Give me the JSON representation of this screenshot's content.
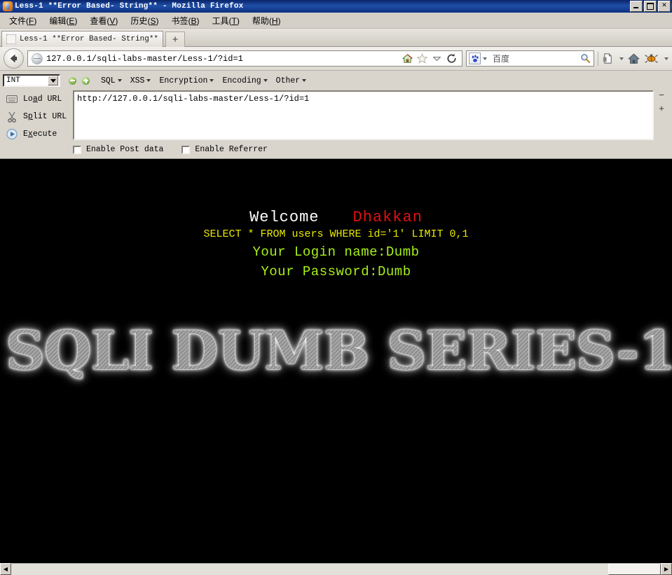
{
  "window": {
    "title": "Less-1 **Error Based- String** - Mozilla Firefox",
    "minimize_label": "Minimize",
    "restore_label": "Restore",
    "close_label": "✕"
  },
  "menubar": {
    "items": [
      {
        "text": "文件",
        "accel": "F"
      },
      {
        "text": "编辑",
        "accel": "E"
      },
      {
        "text": "查看",
        "accel": "V"
      },
      {
        "text": "历史",
        "accel": "S"
      },
      {
        "text": "书签",
        "accel": "B"
      },
      {
        "text": "工具",
        "accel": "T"
      },
      {
        "text": "帮助",
        "accel": "H"
      }
    ]
  },
  "tabbar": {
    "tab_label": "Less-1 **Error Based- String**",
    "newtab_label": "+"
  },
  "navbar": {
    "url": "127.0.0.1/sqli-labs-master/Less-1/?id=1",
    "search_placeholder": "百度",
    "icons": {
      "back": "back-arrow-icon",
      "favicon": "globe-favicon-icon",
      "home_small": "home-icon",
      "star": "star-bookmark-icon",
      "dropdown": "chevron-down-icon",
      "reload": "reload-icon",
      "search_engine": "baidu-paw-icon",
      "search_go": "magnifier-icon",
      "bookmark_sidebar": "page-bookmark-icon",
      "home_toolbar": "home-icon",
      "hackbar": "bug-icon"
    }
  },
  "hackbar": {
    "type_select": "INT",
    "icon_minus": "minus-circle-icon",
    "icon_plus": "plus-circle-icon",
    "menus": [
      {
        "label": "SQL"
      },
      {
        "label": "XSS"
      },
      {
        "label": "Encryption"
      },
      {
        "label": "Encoding"
      },
      {
        "label": "Other"
      }
    ],
    "buttons": [
      {
        "label_pre": "Lo",
        "label_accel": "a",
        "label_post": "d URL",
        "icon": "load-url-icon"
      },
      {
        "label_pre": "S",
        "label_accel": "p",
        "label_post": "lit URL",
        "icon": "split-url-scissors-icon"
      },
      {
        "label_pre": "E",
        "label_accel": "x",
        "label_post": "ecute",
        "icon": "execute-play-icon"
      }
    ],
    "textarea_value": "http://127.0.0.1/sqli-labs-master/Less-1/?id=1",
    "zoom_out": "−",
    "zoom_in": "+",
    "checkboxes": [
      {
        "label": "Enable Post data",
        "checked": false
      },
      {
        "label": "Enable Referrer",
        "checked": false
      }
    ]
  },
  "page": {
    "welcome": "Welcome",
    "welcome_name": "Dhakkan",
    "sql": "SELECT * FROM users WHERE id='1' LIMIT 0,1",
    "login_line": "Your Login name:Dumb",
    "password_line": "Your Password:Dumb",
    "banner": "SQLI DUMB SERIES-1",
    "colors": {
      "background": "#000000",
      "welcome": "#ffffff",
      "name": "#e01010",
      "sql": "#e8e800",
      "credentials": "#a8f018",
      "banner": "#8e8e8e"
    }
  },
  "scrollbar": {
    "left_arrow": "◀",
    "right_arrow": "▶"
  }
}
